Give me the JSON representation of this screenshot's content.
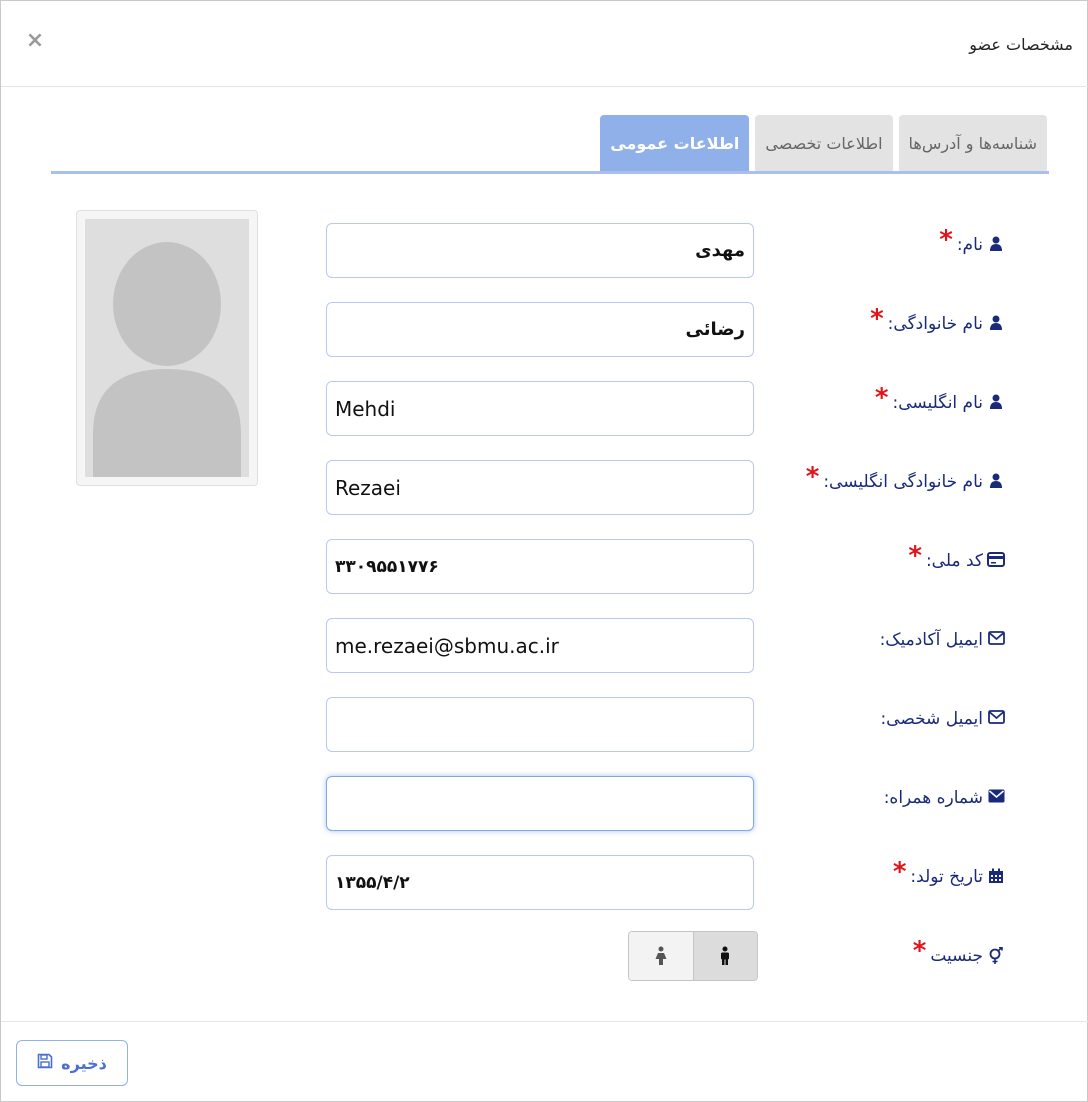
{
  "dialog": {
    "title": "مشخصات عضو",
    "close_label": "×"
  },
  "tabs": [
    {
      "label": "اطلاعات عمومی",
      "active": true
    },
    {
      "label": "اطلاعات تخصصی",
      "active": false
    },
    {
      "label": "شناسه‌ها و آدرس‌ها",
      "active": false
    }
  ],
  "form": {
    "first_name": {
      "label": "نام:",
      "value": "مهدی",
      "required": true,
      "icon": "user-icon"
    },
    "last_name": {
      "label": "نام خانوادگی:",
      "value": "رضائی",
      "required": true,
      "icon": "user-icon"
    },
    "english_name": {
      "label": "نام انگلیسی:",
      "value": "Mehdi",
      "required": true,
      "icon": "user-icon"
    },
    "english_last_name": {
      "label": "نام خانوادگی انگلیسی:",
      "value": "Rezaei",
      "required": true,
      "icon": "user-icon"
    },
    "national_code": {
      "label": "کد ملی:",
      "value": "۳۳۰۹۵۵۱۷۷۶",
      "required": true,
      "icon": "id-card-icon"
    },
    "academic_email": {
      "label": "ایمیل آکادمیک:",
      "value": "me.rezaei@sbmu.ac.ir",
      "required": false,
      "icon": "envelope-outline-icon"
    },
    "personal_email": {
      "label": "ایمیل شخصی:",
      "value": "",
      "required": false,
      "icon": "envelope-outline-icon"
    },
    "mobile": {
      "label": "شماره همراه:",
      "value": "",
      "required": false,
      "icon": "envelope-solid-icon"
    },
    "birth_date": {
      "label": "تاریخ تولد:",
      "value": "۱۳۵۵/۴/۲",
      "required": true,
      "icon": "calendar-icon"
    },
    "gender": {
      "label": "جنسیت",
      "required": true,
      "icon": "gender-icon",
      "options": [
        "male",
        "female"
      ],
      "selected": "male"
    }
  },
  "required_mark": "*",
  "footer": {
    "save_label": "ذخیره"
  },
  "colors": {
    "accent": "#8fb0e9",
    "label": "#1a2a7a",
    "required": "#e0151b",
    "field_border": "#b7c9f3"
  }
}
